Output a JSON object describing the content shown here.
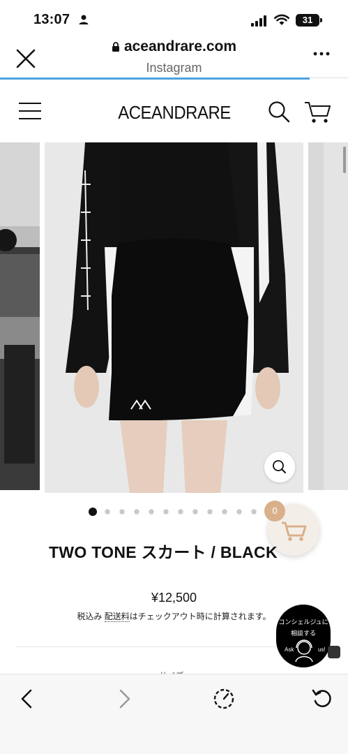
{
  "status_bar": {
    "time": "13:07",
    "battery": "31"
  },
  "browser": {
    "url": "aceandrare.com",
    "subtitle": "Instagram",
    "load_progress": 0.89
  },
  "site": {
    "logo": "ACEANDRARE"
  },
  "gallery": {
    "slide_count": 12,
    "active_index": 0
  },
  "cart": {
    "count": "0"
  },
  "product": {
    "title": "TWO TONE スカート / BLACK",
    "price": "¥12,500",
    "tax_prefix": "税込み ",
    "tax_link": "配送料",
    "tax_suffix": "はチェックアウト時に計算されます。",
    "next_section": "サイズ"
  },
  "concierge": {
    "line1": "コンシェルジュに",
    "line2": "相談する",
    "ask_left": "Ask",
    "ask_right": "us!"
  },
  "colors": {
    "accent_bar": "#4aa3df",
    "cart_badge": "#d9b08c",
    "cart_fab": "#f3efe8"
  }
}
